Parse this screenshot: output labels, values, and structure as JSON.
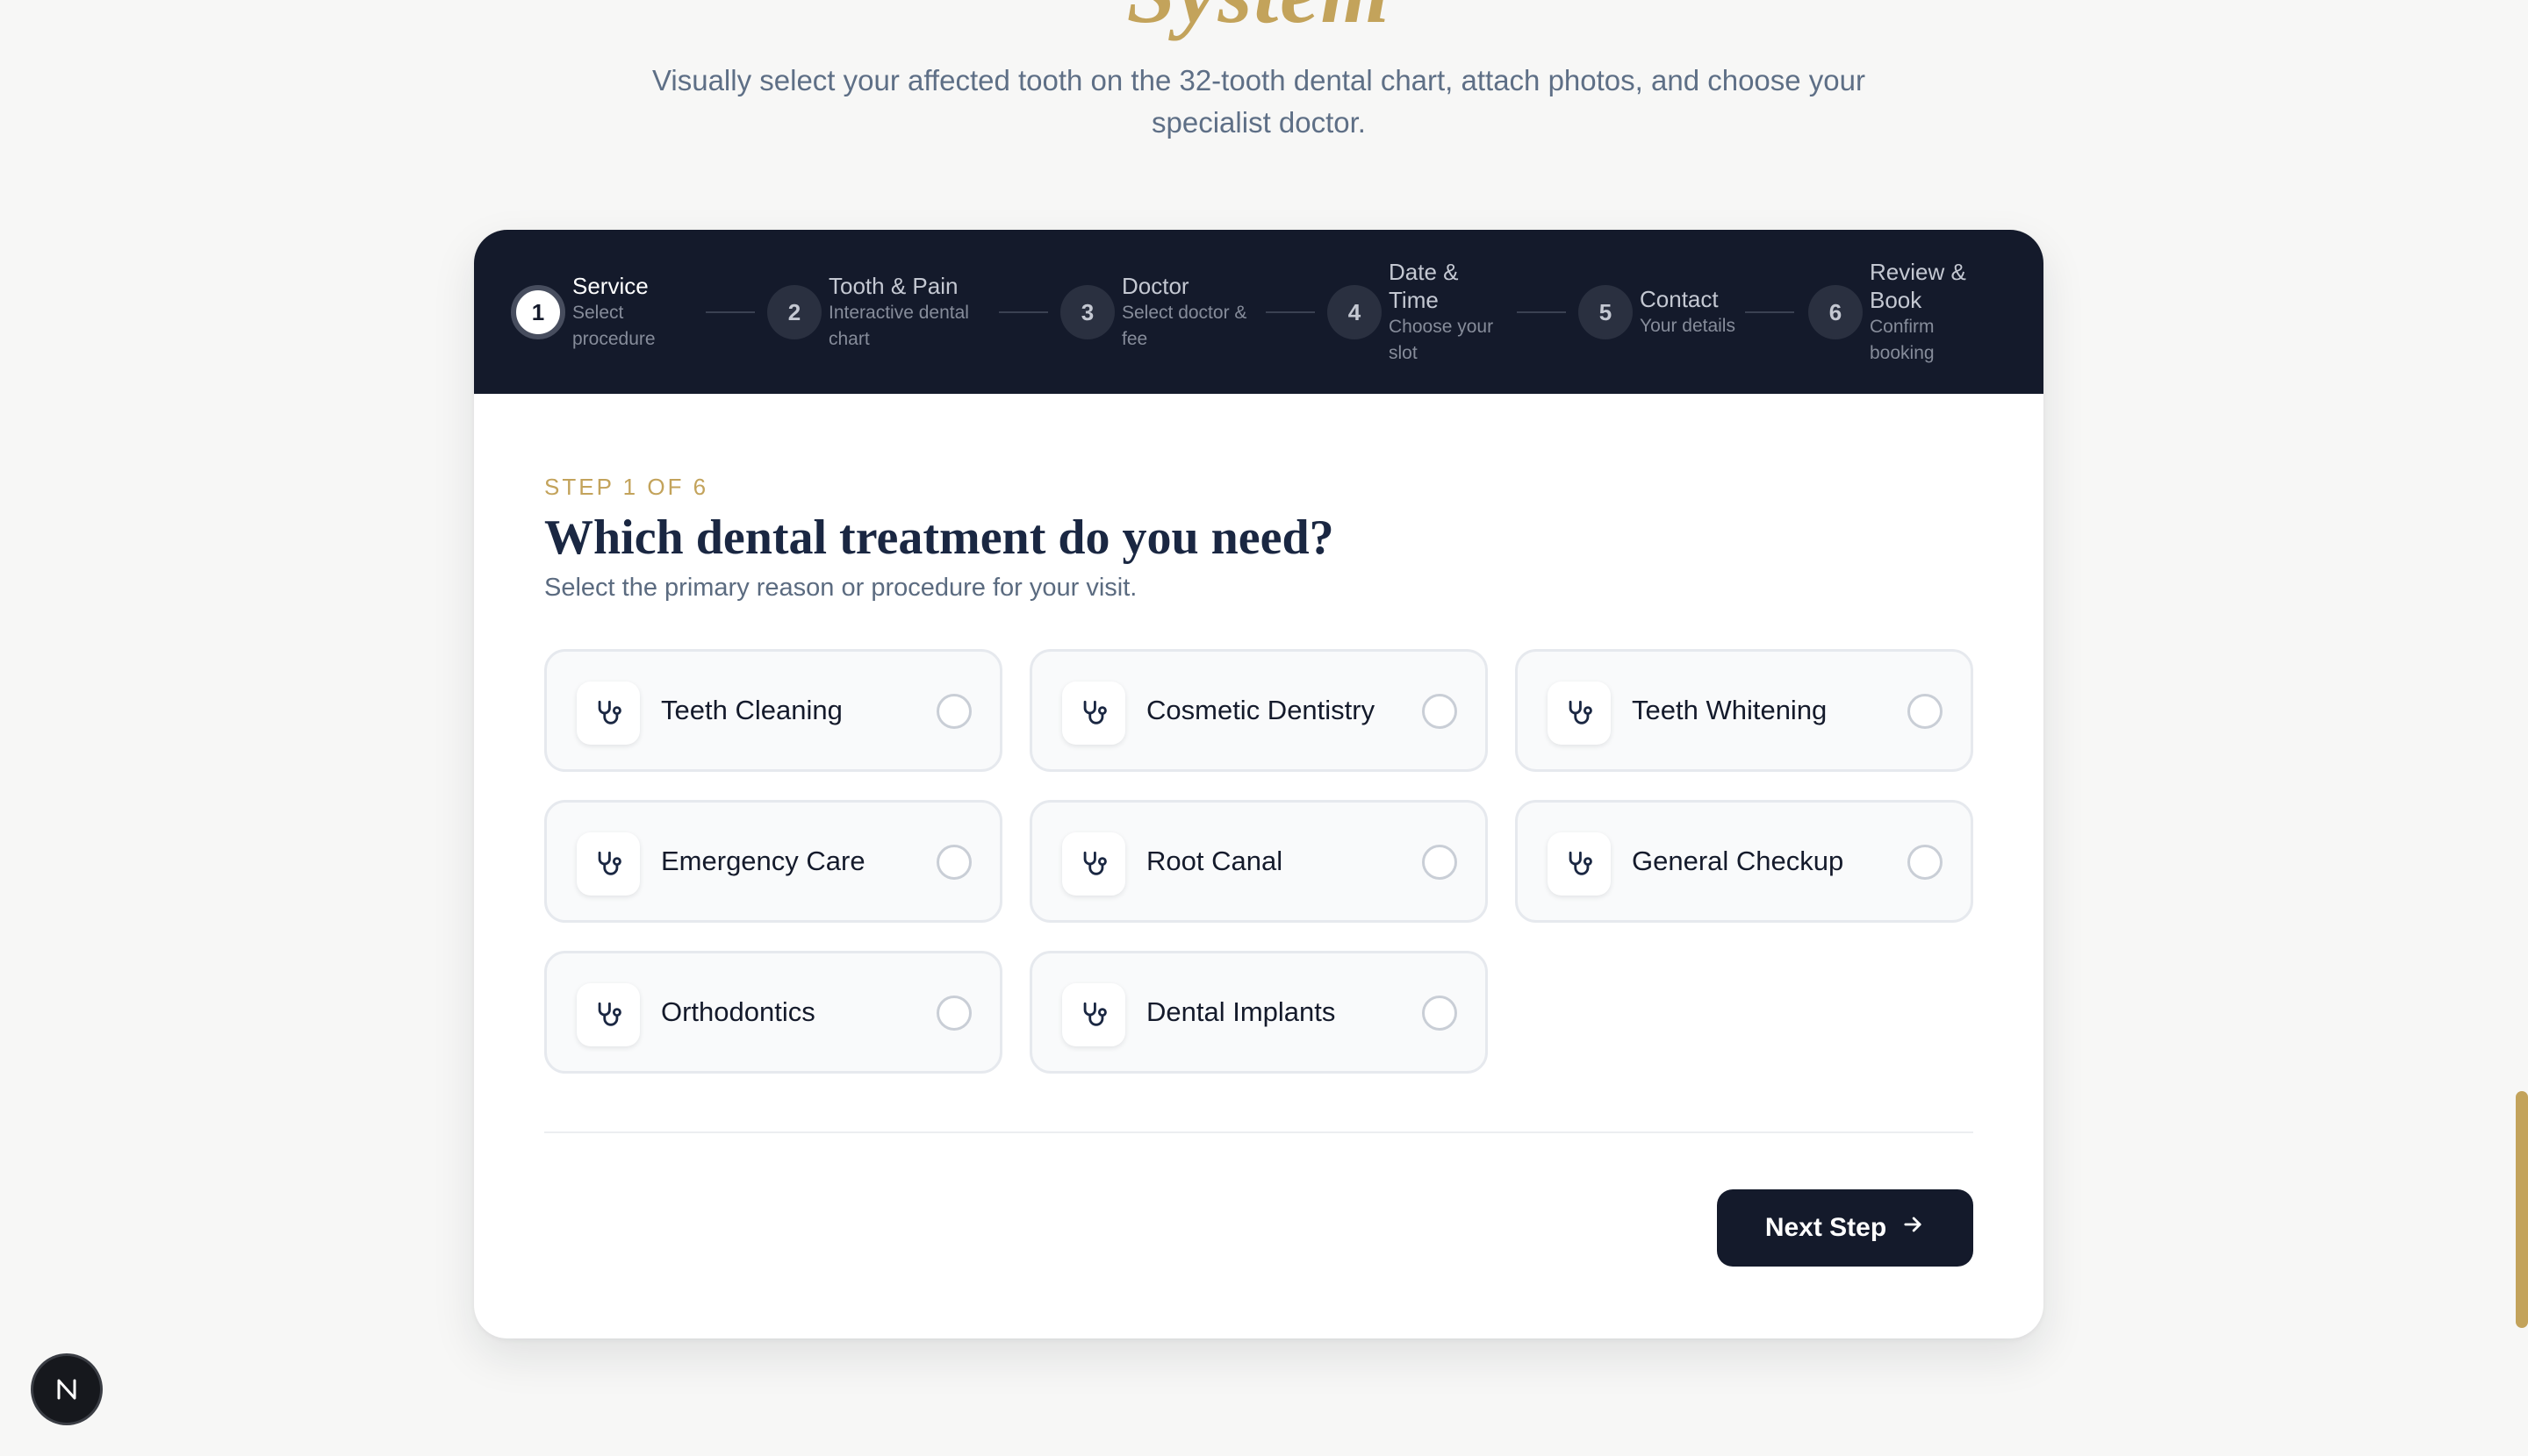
{
  "hero": {
    "title_fragment": "System",
    "subtitle": "Visually select your affected tooth on the 32-tooth dental chart, attach photos, and choose your specialist doctor."
  },
  "stepper": {
    "steps": [
      {
        "number": "1",
        "label": "Service",
        "sub": "Select procedure",
        "active": true
      },
      {
        "number": "2",
        "label": "Tooth & Pain",
        "sub": "Interactive dental chart",
        "active": false
      },
      {
        "number": "3",
        "label": "Doctor",
        "sub": "Select doctor & fee",
        "active": false
      },
      {
        "number": "4",
        "label": "Date & Time",
        "sub": "Choose your slot",
        "active": false
      },
      {
        "number": "5",
        "label": "Contact",
        "sub": "Your details",
        "active": false
      },
      {
        "number": "6",
        "label": "Review & Book",
        "sub": "Confirm booking",
        "active": false
      }
    ]
  },
  "form": {
    "step_indicator": "STEP 1 OF 6",
    "title": "Which dental treatment do you need?",
    "subtitle": "Select the primary reason or procedure for your visit.",
    "options": [
      {
        "name": "Teeth Cleaning",
        "icon": "stethoscope-icon",
        "selected": false
      },
      {
        "name": "Cosmetic Dentistry",
        "icon": "stethoscope-icon",
        "selected": false
      },
      {
        "name": "Teeth Whitening",
        "icon": "stethoscope-icon",
        "selected": false
      },
      {
        "name": "Emergency Care",
        "icon": "stethoscope-icon",
        "selected": false
      },
      {
        "name": "Root Canal",
        "icon": "stethoscope-icon",
        "selected": false
      },
      {
        "name": "General Checkup",
        "icon": "stethoscope-icon",
        "selected": false
      },
      {
        "name": "Orthodontics",
        "icon": "stethoscope-icon",
        "selected": false
      },
      {
        "name": "Dental Implants",
        "icon": "stethoscope-icon",
        "selected": false
      }
    ],
    "next_label": "Next Step"
  },
  "colors": {
    "accent_gold": "#c3a35b",
    "navy": "#141a2b",
    "heading": "#1a2742"
  },
  "badge": {
    "letter": "N"
  }
}
